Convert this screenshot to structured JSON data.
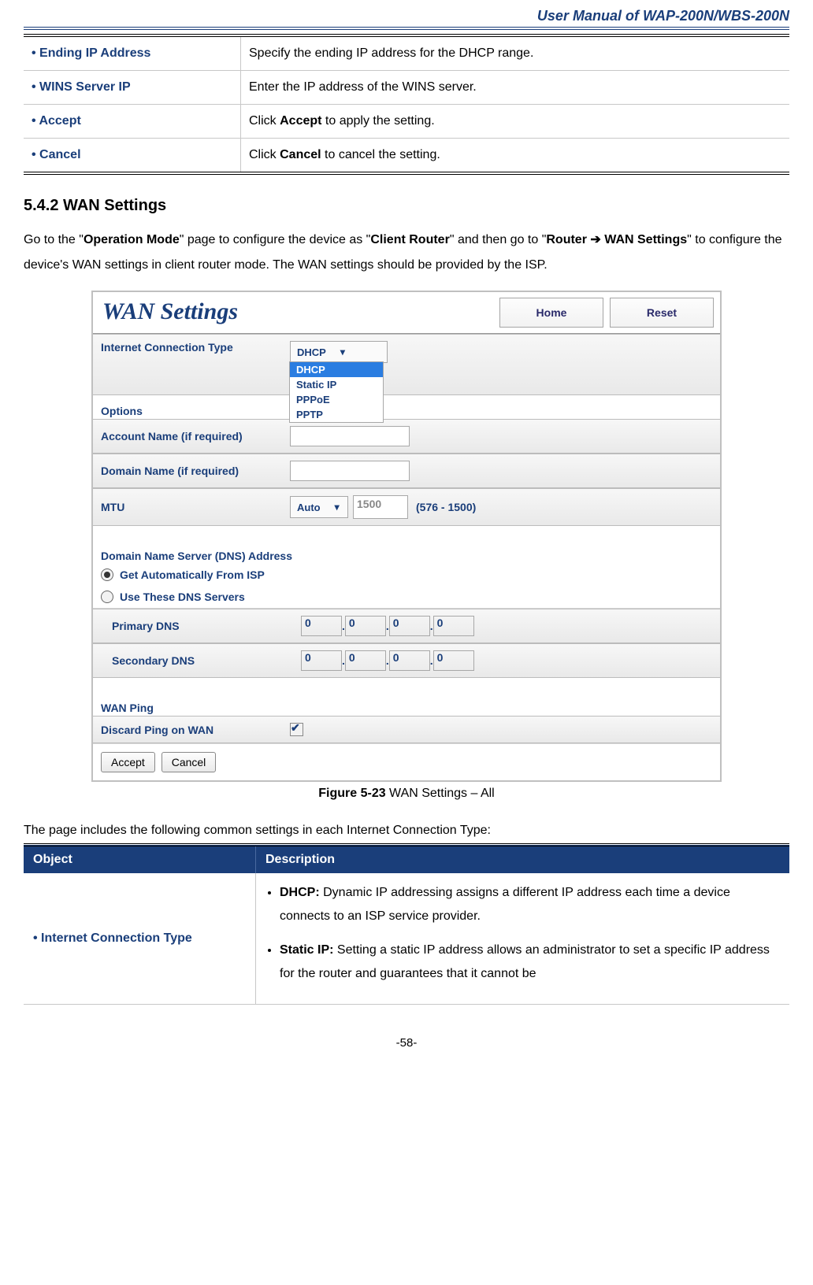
{
  "header": {
    "title": "User Manual of WAP-200N/WBS-200N"
  },
  "table1": {
    "rows": [
      {
        "obj": "Ending IP Address",
        "desc": "Specify the ending IP address for the DHCP range."
      },
      {
        "obj": "WINS Server IP",
        "desc": "Enter the IP address of the WINS server."
      },
      {
        "obj": "Accept",
        "desc_pre": "Click ",
        "desc_bold": "Accept",
        "desc_post": " to apply the setting."
      },
      {
        "obj": "Cancel",
        "desc_pre": "Click ",
        "desc_bold": "Cancel",
        "desc_post": " to cancel the setting."
      }
    ]
  },
  "section": {
    "heading": "5.4.2   WAN Settings",
    "p_parts": {
      "t1": "Go to the \"",
      "b1": "Operation Mode",
      "t2": "\" page to configure the device as \"",
      "b2": "Client Router",
      "t3": "\" and then go to \"",
      "b3": "Router ➔ WAN Settings",
      "t4": "\" to configure the device's WAN settings in client router mode. The WAN settings should be provided by the ISP."
    }
  },
  "screenshot": {
    "title": "WAN Settings",
    "top_buttons": {
      "home": "Home",
      "reset": "Reset"
    },
    "rows": {
      "conn_label": "Internet Connection Type",
      "conn_value": "DHCP",
      "conn_options": [
        "DHCP",
        "Static IP",
        "PPPoE",
        "PPTP"
      ],
      "options_label": "Options",
      "account_label": "Account Name (if required)",
      "domain_label": "Domain Name (if required)",
      "mtu_label": "MTU",
      "mtu_mode": "Auto",
      "mtu_value": "1500",
      "mtu_hint": "(576 - 1500)",
      "dns_head": "Domain Name Server (DNS) Address",
      "dns_auto": "Get Automatically From ISP",
      "dns_use": "Use These DNS Servers",
      "primary_dns": "Primary DNS",
      "secondary_dns": "Secondary DNS",
      "octet": "0",
      "wanping_head": "WAN Ping",
      "discard_label": "Discard Ping on WAN"
    },
    "buttons": {
      "accept": "Accept",
      "cancel": "Cancel"
    }
  },
  "figure_caption": {
    "bold": "Figure 5-23",
    "rest": " WAN Settings – All"
  },
  "intro2": "The page includes the following common settings in each Internet Connection Type:",
  "table2": {
    "head_obj": "Object",
    "head_desc": "Description",
    "row_obj": "Internet Connection Type",
    "li1_b": "DHCP:",
    "li1_t": " Dynamic IP addressing assigns a different IP address each time a device connects to an ISP service provider.",
    "li2_b": "Static IP:",
    "li2_t": " Setting a static IP address allows an administrator to set a specific IP address for the router and guarantees that it cannot be"
  },
  "footer": "-58-"
}
